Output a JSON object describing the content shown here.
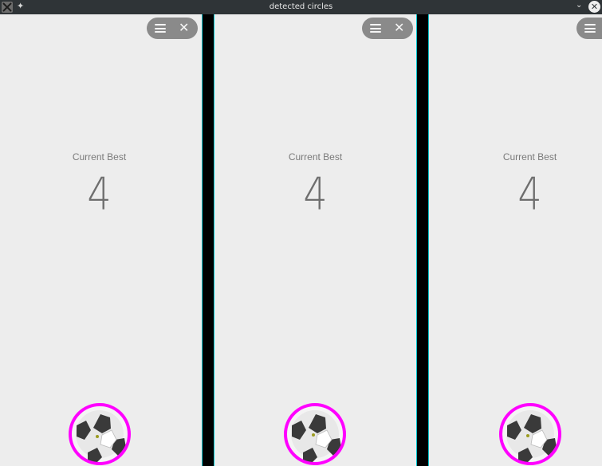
{
  "window": {
    "title": "detected circles"
  },
  "panels": [
    {
      "best_label": "Current Best",
      "best_value": "4",
      "has_close": true
    },
    {
      "best_label": "Current Best",
      "best_value": "4",
      "has_close": true
    },
    {
      "best_label": "Current Best",
      "best_value": "4",
      "has_close": false
    }
  ],
  "colors": {
    "circle_highlight": "#ff00ff",
    "divider": "#00c7d0",
    "panel_bg": "#ededed",
    "pill_bg": "#8a8a8a"
  },
  "icons": {
    "menu": "menu-icon",
    "close": "close-icon",
    "ball": "soccer-ball-icon"
  }
}
